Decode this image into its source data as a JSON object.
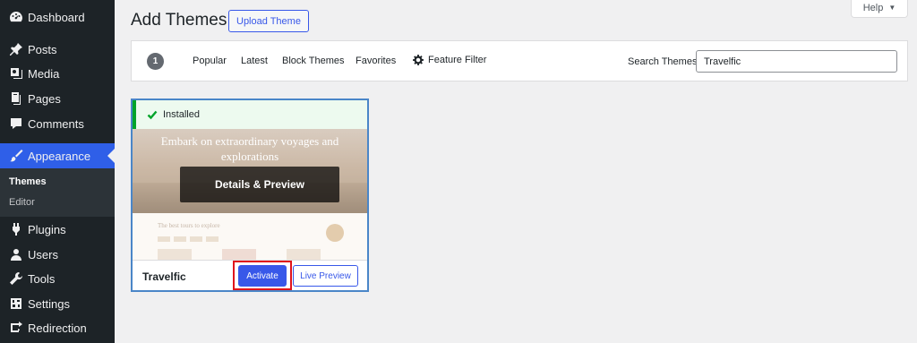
{
  "sidebar": {
    "items": [
      {
        "label": "Dashboard",
        "icon": "dashboard-icon"
      },
      {
        "label": "Posts",
        "icon": "pin-icon"
      },
      {
        "label": "Media",
        "icon": "media-icon"
      },
      {
        "label": "Pages",
        "icon": "pages-icon"
      },
      {
        "label": "Comments",
        "icon": "comments-icon"
      },
      {
        "label": "Appearance",
        "icon": "brush-icon",
        "active": true
      },
      {
        "label": "Plugins",
        "icon": "plugin-icon"
      },
      {
        "label": "Users",
        "icon": "users-icon"
      },
      {
        "label": "Tools",
        "icon": "wrench-icon"
      },
      {
        "label": "Settings",
        "icon": "settings-icon"
      },
      {
        "label": "Redirection",
        "icon": "redirect-icon"
      }
    ],
    "submenu": [
      {
        "label": "Themes",
        "current": true
      },
      {
        "label": "Editor"
      }
    ]
  },
  "header": {
    "title": "Add Themes",
    "upload_label": "Upload Theme",
    "help_label": "Help"
  },
  "filter": {
    "count": "1",
    "tabs": [
      "Popular",
      "Latest",
      "Block Themes",
      "Favorites"
    ],
    "feature_filter": "Feature Filter",
    "search_label": "Search Themes",
    "search_value": "Travelfic"
  },
  "theme": {
    "status": "Installed",
    "preview_heading": "Embark on extraordinary voyages and explorations",
    "preview_subheading": "The best tours to explore",
    "details_label": "Details & Preview",
    "name": "Travelfic",
    "activate_label": "Activate",
    "live_preview_label": "Live Preview"
  },
  "colors": {
    "sidebar_bg": "#1d2327",
    "accent": "#3858e9",
    "installed_green": "#00a32a",
    "highlight_red": "#e0141c"
  }
}
